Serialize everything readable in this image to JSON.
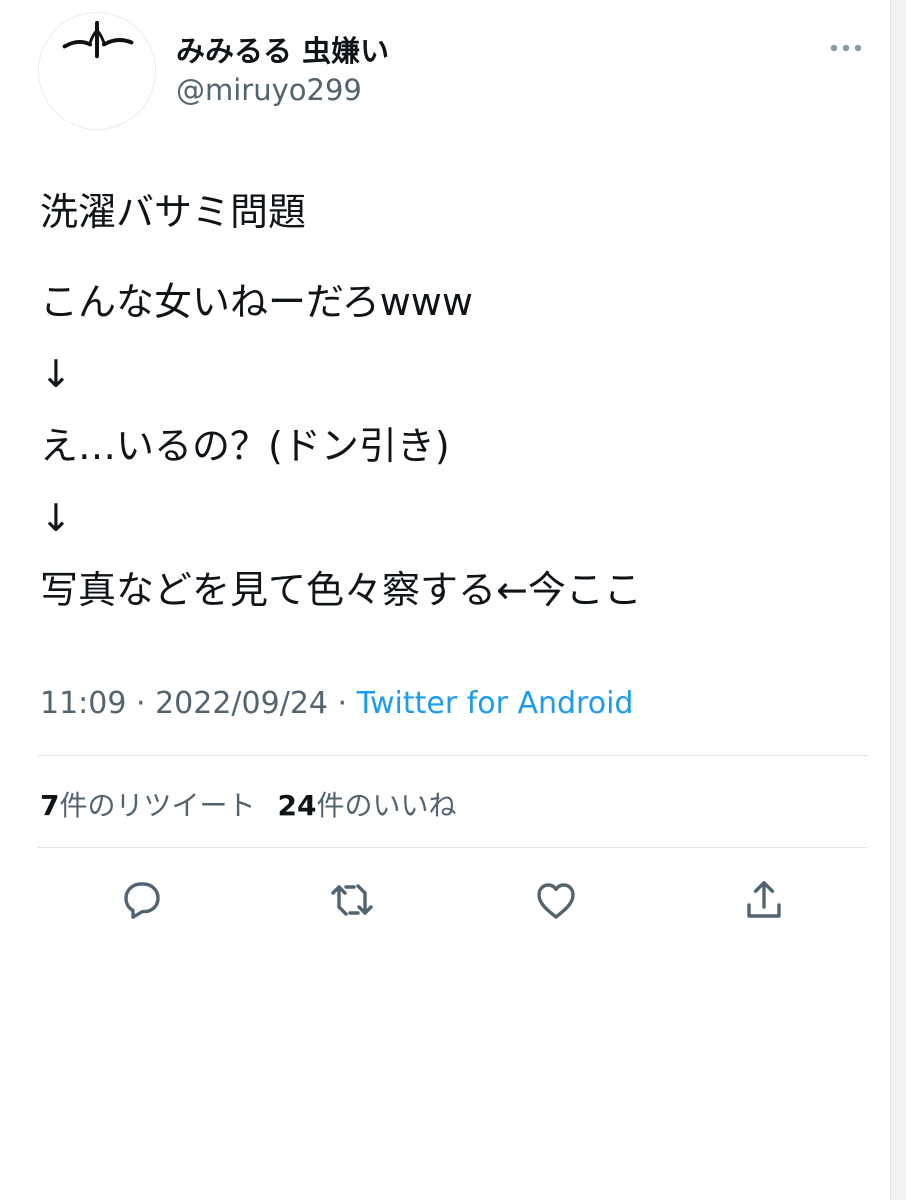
{
  "tweet": {
    "author": {
      "display_name": "みみるる 虫嫌い",
      "handle": "@miruyo299"
    },
    "lines": [
      "洗濯バサミ問題",
      "こんな女いねーだろwww",
      "↓",
      "え…いるの？(ドン引き)",
      "↓",
      "写真などを見て色々察する←今ここ"
    ],
    "time": "11:09",
    "separator": " · ",
    "date": "2022/09/24",
    "source": "Twitter for Android",
    "stats": {
      "retweet_count": "7",
      "retweet_label": "件のリツイート",
      "like_count": "24",
      "like_label": "件のいいね"
    }
  },
  "icons": {
    "more": "more-horizontal-icon",
    "reply": "reply-icon",
    "retweet": "retweet-icon",
    "like": "heart-icon",
    "share": "share-icon"
  },
  "colors": {
    "text": "#0f1419",
    "secondary": "#536471",
    "link": "#1d9bf0",
    "divider": "#e1e6ea"
  }
}
